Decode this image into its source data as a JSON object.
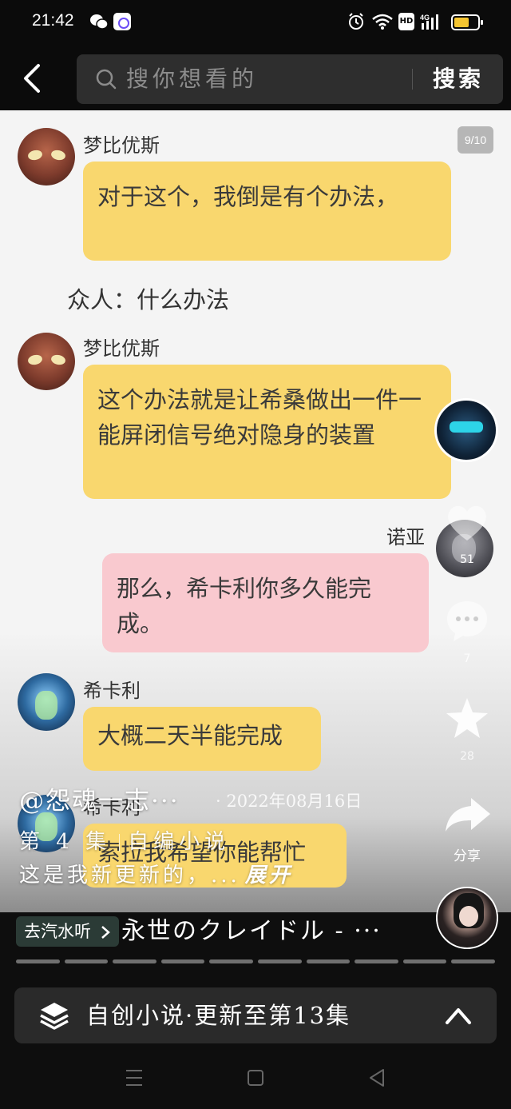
{
  "status_bar": {
    "time": "21:42",
    "icons": [
      "wechat-icon",
      "app-icon",
      "alarm-icon",
      "wifi-icon",
      "hd-icon",
      "signal-icon",
      "battery-icon"
    ],
    "hd_label": "HD",
    "network_label": "4G"
  },
  "header": {
    "search_placeholder": "搜你想看的",
    "search_button": "搜索"
  },
  "comic": {
    "page_indicator": "9/10",
    "messages": [
      {
        "speaker": "梦比优斯",
        "text": "对于这个，我倒是有个办法，"
      },
      {
        "narration": "众人：什么办法"
      },
      {
        "speaker": "梦比优斯",
        "text": "这个办法就是让希桑做出一件一能屏闭信号绝对隐身的装置"
      },
      {
        "speaker": "诺亚",
        "text": "那么，希卡利你多久能完成。"
      },
      {
        "speaker": "希卡利",
        "text": "大概二天半能完成"
      },
      {
        "speaker": "希卡利",
        "text": "索拉我希望你能帮忙"
      }
    ]
  },
  "side_actions": {
    "like_count": "51",
    "comment_count": "7",
    "favorite_count": "28",
    "share_label": "分享"
  },
  "post": {
    "author": "@怨魂一志···",
    "date": "· 2022年08月16日",
    "episode": "第 4 集",
    "tag": "自编小说",
    "caption": "这是我新更新的，...",
    "expand": "展开"
  },
  "music": {
    "tag": "去汽水听",
    "title": "永世のクレイドル - ···"
  },
  "collection": {
    "label": "自创小说·更新至第13集"
  },
  "colors": {
    "bubble_yellow": "#f9d76e",
    "bubble_pink": "#f9c9cf",
    "background": "#f4f4f4"
  }
}
